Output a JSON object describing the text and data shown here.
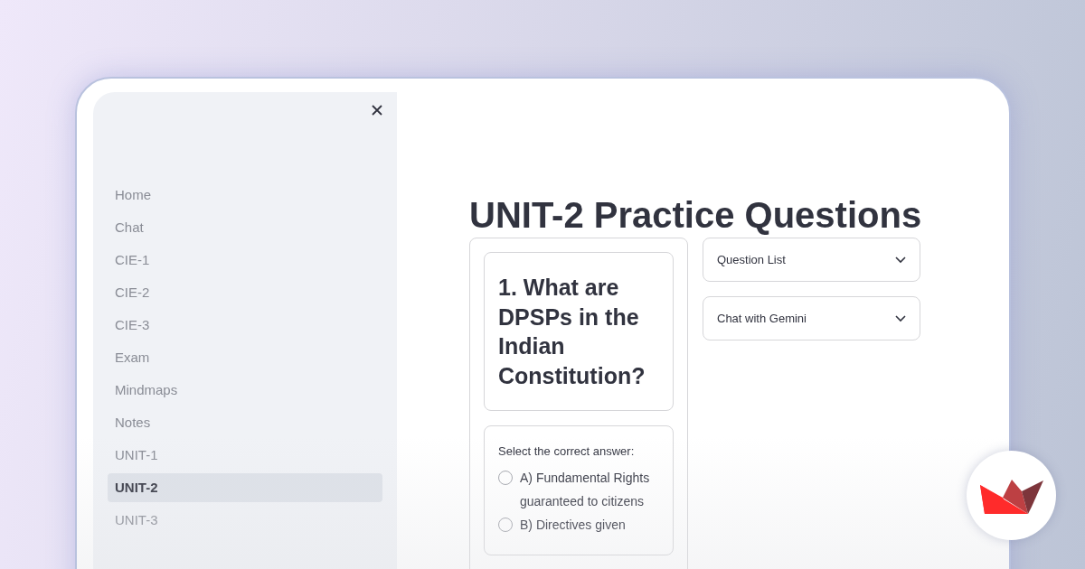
{
  "sidebar": {
    "items": [
      {
        "label": "Home",
        "selected": false
      },
      {
        "label": "Chat",
        "selected": false
      },
      {
        "label": "CIE-1",
        "selected": false
      },
      {
        "label": "CIE-2",
        "selected": false
      },
      {
        "label": "CIE-3",
        "selected": false
      },
      {
        "label": "Exam",
        "selected": false
      },
      {
        "label": "Mindmaps",
        "selected": false
      },
      {
        "label": "Notes",
        "selected": false
      },
      {
        "label": "UNIT-1",
        "selected": false
      },
      {
        "label": "UNIT-2",
        "selected": true
      },
      {
        "label": "UNIT-3",
        "selected": false
      }
    ]
  },
  "title": "UNIT-2 Practice Questions",
  "question": {
    "heading": "1. What are DPSPs in the Indian Constitution?",
    "prompt": "Select the correct answer:",
    "options": [
      {
        "label": "A) Fundamental Rights guaranteed to citizens",
        "selected": false
      },
      {
        "label": "B) Directives given",
        "selected": false
      }
    ]
  },
  "expanders": [
    {
      "label": "Question List",
      "expanded": false
    },
    {
      "label": "Chat with Gemini",
      "expanded": false
    }
  ]
}
